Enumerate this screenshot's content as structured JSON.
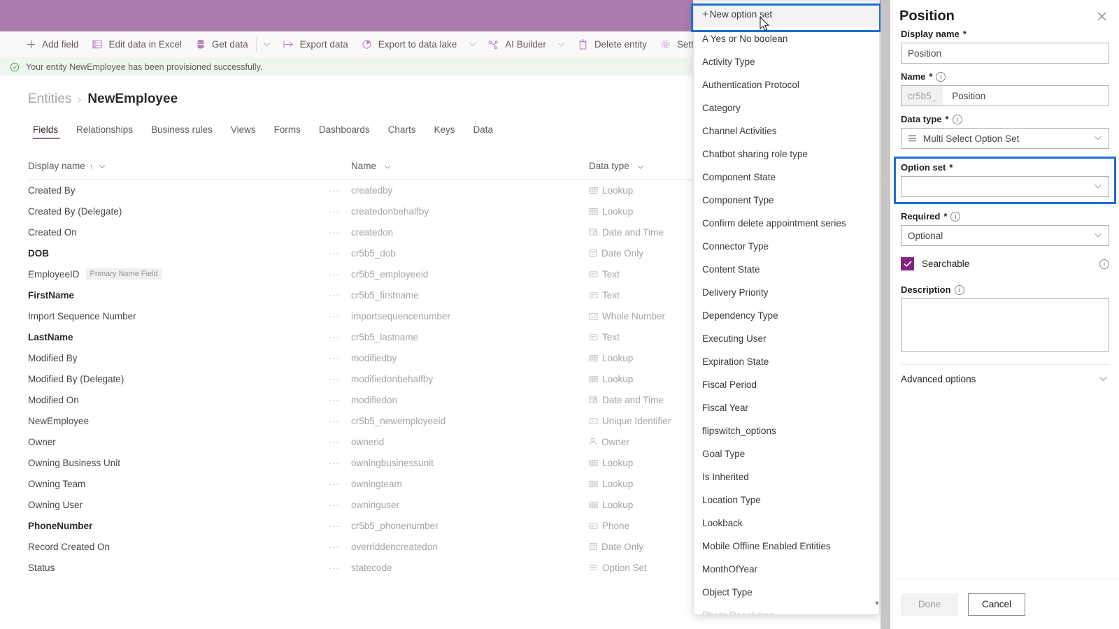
{
  "header": {
    "bar_color": "#ab7aae"
  },
  "command_bar": {
    "items": [
      {
        "label": "Add field",
        "icon": "plus-icon",
        "caret": false
      },
      {
        "label": "Edit data in Excel",
        "icon": "excel-icon",
        "caret": false
      },
      {
        "label": "Get data",
        "icon": "database-icon",
        "caret": true
      },
      {
        "label": "Export data",
        "icon": "export-icon",
        "caret": false
      },
      {
        "label": "Export to data lake",
        "icon": "datalake-icon",
        "caret": true
      },
      {
        "label": "AI Builder",
        "icon": "ai-builder-icon",
        "caret": true
      },
      {
        "label": "Delete entity",
        "icon": "trash-icon",
        "caret": false
      },
      {
        "label": "Settings",
        "icon": "gear-icon",
        "caret": false
      }
    ]
  },
  "notification": {
    "icon": "check-circle-icon",
    "message": "Your entity NewEmployee has been provisioned successfully."
  },
  "breadcrumb": {
    "parent": "Entities",
    "separator": "›",
    "current": "NewEmployee"
  },
  "tabs": [
    {
      "label": "Fields",
      "active": true
    },
    {
      "label": "Relationships",
      "active": false
    },
    {
      "label": "Business rules",
      "active": false
    },
    {
      "label": "Views",
      "active": false
    },
    {
      "label": "Forms",
      "active": false
    },
    {
      "label": "Dashboards",
      "active": false
    },
    {
      "label": "Charts",
      "active": false
    },
    {
      "label": "Keys",
      "active": false
    },
    {
      "label": "Data",
      "active": false
    }
  ],
  "grid": {
    "columns": [
      {
        "label": "Display name",
        "sorted": true,
        "sort_arrow": "↑"
      },
      {
        "label": "Name",
        "sorted": false
      },
      {
        "label": "Data type",
        "sorted": false
      }
    ],
    "ellipsis": "···",
    "rows": [
      {
        "display": "Created By",
        "bold": false,
        "badge": "",
        "name": "createdby",
        "type": "Lookup",
        "type_icon": "lookup-icon"
      },
      {
        "display": "Created By (Delegate)",
        "bold": false,
        "badge": "",
        "name": "createdonbehalfby",
        "type": "Lookup",
        "type_icon": "lookup-icon"
      },
      {
        "display": "Created On",
        "bold": false,
        "badge": "",
        "name": "createdon",
        "type": "Date and Time",
        "type_icon": "datetime-icon"
      },
      {
        "display": "DOB",
        "bold": true,
        "badge": "",
        "name": "cr5b5_dob",
        "type": "Date Only",
        "type_icon": "dateonly-icon"
      },
      {
        "display": "EmployeeID",
        "bold": false,
        "badge": "Primary Name Field",
        "name": "cr5b5_employeeid",
        "type": "Text",
        "type_icon": "text-icon"
      },
      {
        "display": "FirstName",
        "bold": true,
        "badge": "",
        "name": "cr5b5_firstname",
        "type": "Text",
        "type_icon": "text-icon"
      },
      {
        "display": "Import Sequence Number",
        "bold": false,
        "badge": "",
        "name": "importsequencenumber",
        "type": "Whole Number",
        "type_icon": "number-icon"
      },
      {
        "display": "LastName",
        "bold": true,
        "badge": "",
        "name": "cr5b5_lastname",
        "type": "Text",
        "type_icon": "text-icon"
      },
      {
        "display": "Modified By",
        "bold": false,
        "badge": "",
        "name": "modifiedby",
        "type": "Lookup",
        "type_icon": "lookup-icon"
      },
      {
        "display": "Modified By (Delegate)",
        "bold": false,
        "badge": "",
        "name": "modifiedonbehalfby",
        "type": "Lookup",
        "type_icon": "lookup-icon"
      },
      {
        "display": "Modified On",
        "bold": false,
        "badge": "",
        "name": "modifiedon",
        "type": "Date and Time",
        "type_icon": "datetime-icon"
      },
      {
        "display": "NewEmployee",
        "bold": false,
        "badge": "",
        "name": "cr5b5_newemployeeid",
        "type": "Unique Identifier",
        "type_icon": "guid-icon"
      },
      {
        "display": "Owner",
        "bold": false,
        "badge": "",
        "name": "ownerid",
        "type": "Owner",
        "type_icon": "person-icon"
      },
      {
        "display": "Owning Business Unit",
        "bold": false,
        "badge": "",
        "name": "owningbusinessunit",
        "type": "Lookup",
        "type_icon": "lookup-icon"
      },
      {
        "display": "Owning Team",
        "bold": false,
        "badge": "",
        "name": "owningteam",
        "type": "Lookup",
        "type_icon": "lookup-icon"
      },
      {
        "display": "Owning User",
        "bold": false,
        "badge": "",
        "name": "owninguser",
        "type": "Lookup",
        "type_icon": "lookup-icon"
      },
      {
        "display": "PhoneNumber",
        "bold": true,
        "badge": "",
        "name": "cr5b5_phonenumber",
        "type": "Phone",
        "type_icon": "phone-icon"
      },
      {
        "display": "Record Created On",
        "bold": false,
        "badge": "",
        "name": "overriddencreatedon",
        "type": "Date Only",
        "type_icon": "dateonly-icon"
      },
      {
        "display": "Status",
        "bold": false,
        "badge": "",
        "name": "statecode",
        "type": "Option Set",
        "type_icon": "optionset-icon"
      }
    ]
  },
  "dropdown": {
    "new_option_set_label": "New option set",
    "highlight_color": "#1f6fd0",
    "scroll_down_arrow": "▼",
    "items": [
      "A Yes or No boolean",
      "Activity Type",
      "Authentication Protocol",
      "Category",
      "Channel Activities",
      "Chatbot sharing role type",
      "Component State",
      "Component Type",
      "Confirm delete appointment series",
      "Connector Type",
      "Content State",
      "Delivery Priority",
      "Dependency Type",
      "Executing User",
      "Expiration State",
      "Fiscal Period",
      "Fiscal Year",
      "flipswitch_options",
      "Goal Type",
      "Is Inherited",
      "Location Type",
      "Lookback",
      "Mobile Offline Enabled Entities",
      "MonthOfYear",
      "Object Type"
    ],
    "partial_item": "Photo Resolution"
  },
  "panel": {
    "title": "Position",
    "close_icon": "close-icon",
    "display_name": {
      "label": "Display name",
      "required": "*",
      "value": "Position"
    },
    "name": {
      "label": "Name",
      "required": "*",
      "prefix": "cr5b5_",
      "value": "Position"
    },
    "data_type": {
      "label": "Data type",
      "required": "*",
      "value": "Multi Select Option Set",
      "icon": "optionset-icon"
    },
    "option_set": {
      "label": "Option set",
      "required": "*",
      "value": "",
      "highlighted": true
    },
    "required_field": {
      "label": "Required",
      "required": "*",
      "value": "Optional"
    },
    "searchable": {
      "label": "Searchable",
      "checked": true,
      "check_color": "#81257f"
    },
    "description": {
      "label": "Description",
      "value": ""
    },
    "advanced_options": {
      "label": "Advanced options"
    },
    "footer": {
      "done_label": "Done",
      "cancel_label": "Cancel"
    }
  }
}
